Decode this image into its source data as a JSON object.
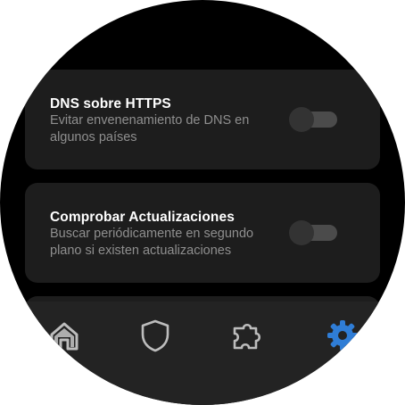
{
  "settings": {
    "items": [
      {
        "title": "DNS sobre HTTPS",
        "description": "Evitar envenenamiento de DNS en algunos países",
        "enabled": false
      },
      {
        "title": "Comprobar Actualizaciones",
        "description": "Buscar periódicamente en segundo plano si existen actualizaciones",
        "enabled": false
      }
    ]
  },
  "navigation": {
    "items": [
      {
        "icon": "home-icon",
        "active": false
      },
      {
        "icon": "shield-icon",
        "active": false
      },
      {
        "icon": "puzzle-icon",
        "active": false
      },
      {
        "icon": "gear-icon",
        "active": true
      }
    ]
  },
  "colors": {
    "background": "#000000",
    "card": "#1d1d1d",
    "navbar": "#232323",
    "active": "#2f7dd6",
    "inactive": "#bdbdbd",
    "switch_track": "#4b4b4b",
    "switch_thumb": "#333333"
  }
}
